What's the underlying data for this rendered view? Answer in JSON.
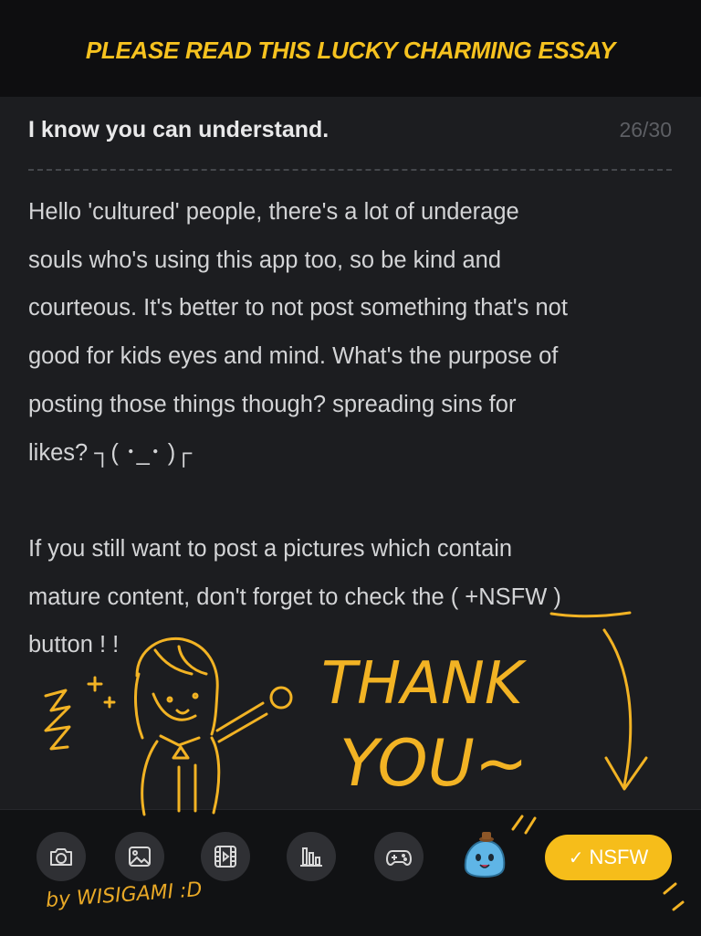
{
  "banner": "PLEASE READ THIS LUCKY CHARMING ESSAY",
  "post": {
    "title": "I know you can understand.",
    "title_counter": "26/30",
    "body": "Hello 'cultured' people, there's a lot of underage\nsouls who's using this app too, so be kind and\ncourteous. It's better to not post something that's not\ngood for kids eyes and mind. What's the purpose of\nposting those things though? spreading sins for\nlikes? ┐( ･_･ )┌\n\nIf you still want to post a pictures which contain\nmature content, don't forget to check the ( +NSFW )\nbutton ! !"
  },
  "doodle": {
    "thank": "THANK",
    "you": "YOU~"
  },
  "toolbar": {
    "buttons": [
      {
        "icon": "camera-icon"
      },
      {
        "icon": "image-icon"
      },
      {
        "icon": "video-icon"
      },
      {
        "icon": "poll-icon"
      },
      {
        "icon": "gamepad-icon"
      }
    ],
    "sticker_icon": "slime-sticker-icon",
    "nsfw_label": "NSFW",
    "nsfw_checked": true
  },
  "signature": "by WISIGAMI :D",
  "colors": {
    "accent": "#f6bd1a",
    "background": "#1c1d20",
    "toolbar_bg": "#111214",
    "text": "#d3d4d6"
  }
}
